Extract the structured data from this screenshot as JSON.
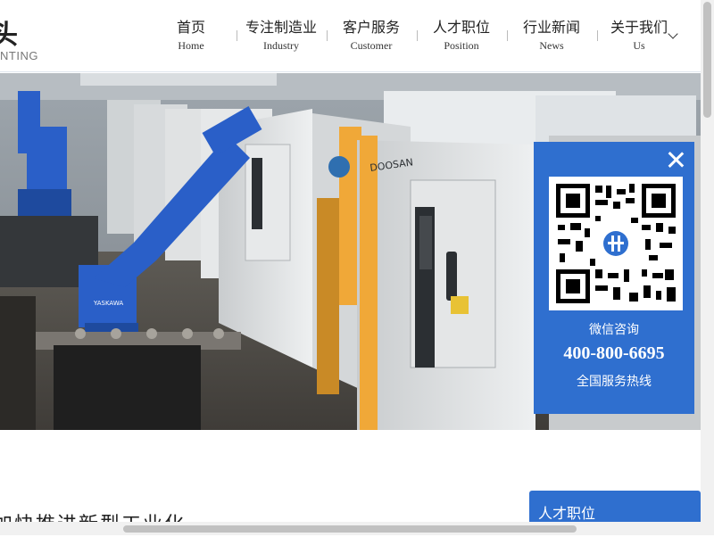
{
  "header": {
    "logo_char": "头",
    "logo_sub": "NTING",
    "nav": [
      {
        "zh": "首页",
        "en": "Home"
      },
      {
        "zh": "专注制造业",
        "en": "Industry"
      },
      {
        "zh": "客户服务",
        "en": "Customer"
      },
      {
        "zh": "人才职位",
        "en": "Position"
      },
      {
        "zh": "行业新闻",
        "en": "News"
      },
      {
        "zh": "关于我们",
        "en": "Us"
      }
    ]
  },
  "hero": {
    "machine_brand": "DOOSAN",
    "robot_brand": "YASKAWA"
  },
  "consult": {
    "title": "微信咨询",
    "phone": "400-800-6695",
    "hotline": "全国服务热线"
  },
  "content": {
    "slogan": "加快推进新型工业化",
    "side_card": "人才职位"
  },
  "colors": {
    "accent": "#2f6fcf",
    "robot": "#2a5fc8"
  }
}
